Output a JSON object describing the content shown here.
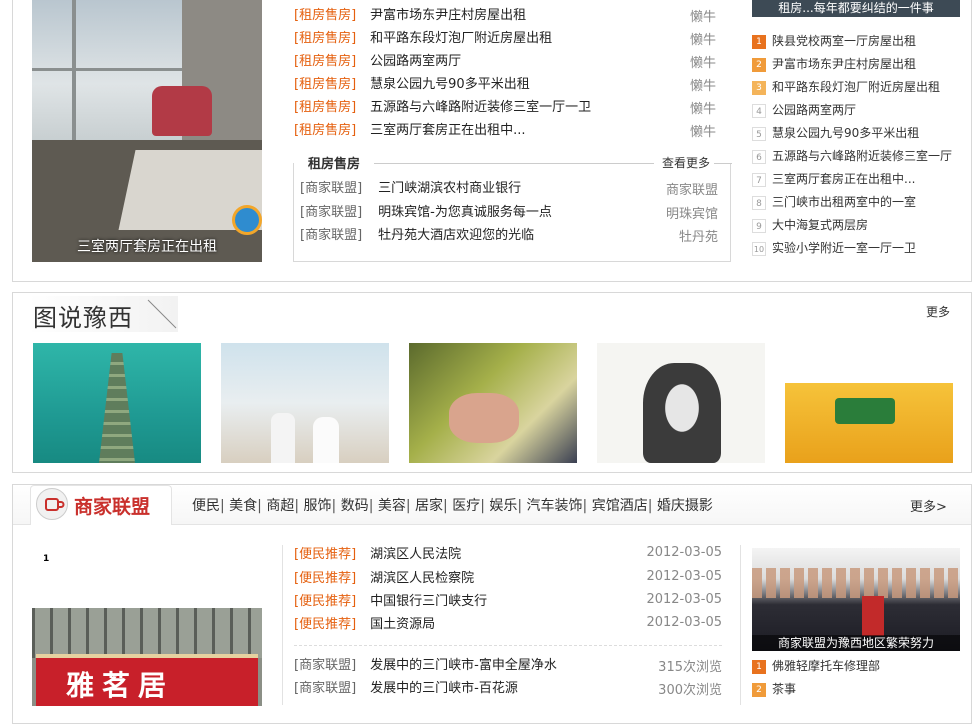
{
  "top": {
    "featured_caption": "三室两厅套房正在出租",
    "listings": [
      {
        "tag": "[租房售房]",
        "title": "尹富市场东尹庄村房屋出租",
        "author": "懒牛"
      },
      {
        "tag": "[租房售房]",
        "title": "和平路东段灯泡厂附近房屋出租",
        "author": "懒牛"
      },
      {
        "tag": "[租房售房]",
        "title": "公园路两室两厅",
        "author": "懒牛"
      },
      {
        "tag": "[租房售房]",
        "title": "慧泉公园九号90多平米出租",
        "author": "懒牛"
      },
      {
        "tag": "[租房售房]",
        "title": "五源路与六峰路附近装修三室一厅一卫",
        "author": "懒牛"
      },
      {
        "tag": "[租房售房]",
        "title": "三室两厅套房正在出租中...",
        "author": "懒牛"
      }
    ],
    "subbox": {
      "title": "租房售房",
      "more": "查看更多",
      "items": [
        {
          "tag": "[商家联盟]",
          "title": "三门峡湖滨农村商业银行",
          "author": "商家联盟"
        },
        {
          "tag": "[商家联盟]",
          "title": "明珠宾馆-为您真诚服务每一点",
          "author": "明珠宾馆"
        },
        {
          "tag": "[商家联盟]",
          "title": "牡丹苑大酒店欢迎您的光临",
          "author": "牡丹苑"
        }
      ]
    },
    "right_caption": "租房...每年都要纠结的一件事",
    "rank": [
      {
        "n": "1",
        "t": "陕县党校两室一厅房屋出租"
      },
      {
        "n": "2",
        "t": "尹富市场东尹庄村房屋出租"
      },
      {
        "n": "3",
        "t": "和平路东段灯泡厂附近房屋出租"
      },
      {
        "n": "4",
        "t": "公园路两室两厅"
      },
      {
        "n": "5",
        "t": "慧泉公园九号90多平米出租"
      },
      {
        "n": "6",
        "t": "五源路与六峰路附近装修三室一厅"
      },
      {
        "n": "7",
        "t": "三室两厅套房正在出租中..."
      },
      {
        "n": "8",
        "t": "三门峡市出租两室中的一室"
      },
      {
        "n": "9",
        "t": "大中海复式两层房"
      },
      {
        "n": "10",
        "t": "实验小学附近一室一厅一卫"
      }
    ]
  },
  "gallery": {
    "title": "图说豫西",
    "more": "更多"
  },
  "merchant": {
    "title": "商家联盟",
    "cats": [
      "便民",
      "美食",
      "商超",
      "服饰",
      "数码",
      "美容",
      "居家",
      "医疗",
      "娱乐",
      "汽车装饰",
      "宾馆酒店",
      "婚庆摄影"
    ],
    "more": "更多>",
    "page_num": "1",
    "shop_sign": "雅茗居",
    "recommend": [
      {
        "tag": "[便民推荐]",
        "title": "湖滨区人民法院",
        "date": "2012-03-05"
      },
      {
        "tag": "[便民推荐]",
        "title": "湖滨区人民检察院",
        "date": "2012-03-05"
      },
      {
        "tag": "[便民推荐]",
        "title": "中国银行三门峡支行",
        "date": "2012-03-05"
      },
      {
        "tag": "[便民推荐]",
        "title": "国土资源局",
        "date": "2012-03-05"
      }
    ],
    "alliance": [
      {
        "tag": "[商家联盟]",
        "title": "发展中的三门峡市-富申全屋净水",
        "views": "315次浏览"
      },
      {
        "tag": "[商家联盟]",
        "title": "发展中的三门峡市-百花源",
        "views": "300次浏览"
      }
    ],
    "right_caption": "商家联盟为豫西地区繁荣努力",
    "rank": [
      {
        "n": "1",
        "t": "佛雅轻摩托车修理部"
      },
      {
        "n": "2",
        "t": "茶事"
      }
    ]
  },
  "colors": {
    "accent": "#e5600f",
    "rank1": "#e8721e",
    "rank2": "#f09b3a",
    "rank3": "#f4b45a"
  }
}
